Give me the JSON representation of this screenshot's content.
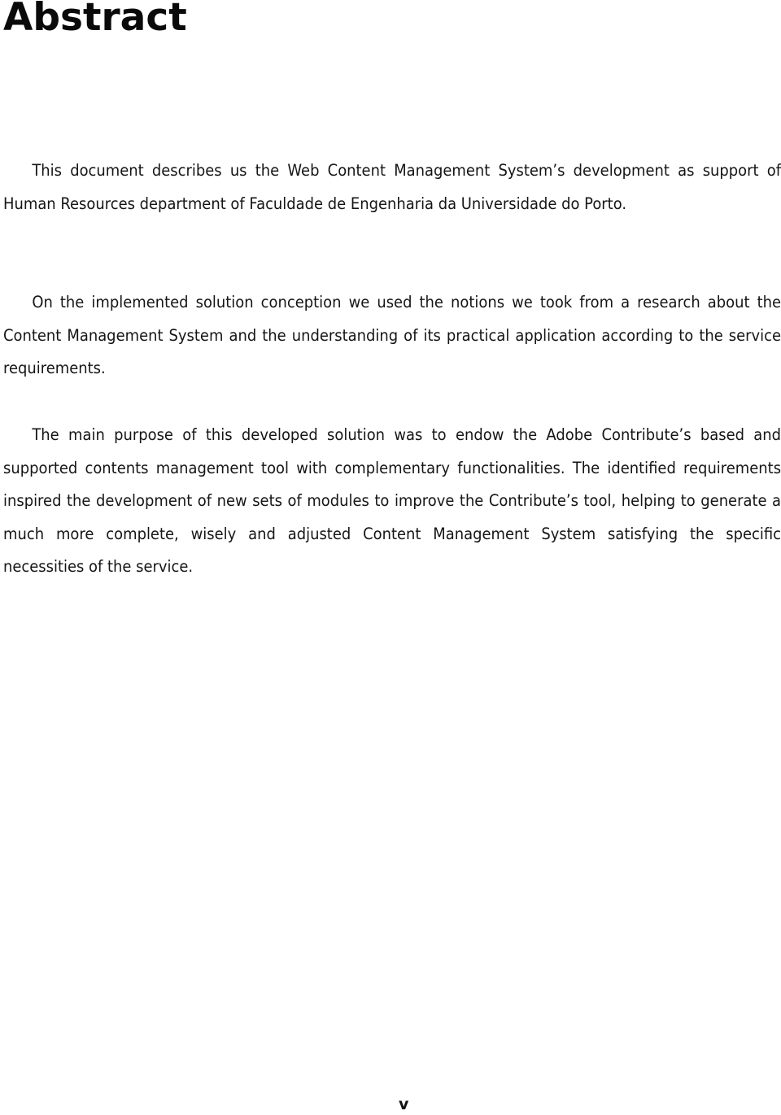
{
  "document": {
    "title": "Abstract",
    "paragraphs": [
      "This document describes us the Web Content Management System’s development as support of Human Resources department of Faculdade de Engenharia da Universidade do Porto.",
      "On the implemented solution conception we used the notions we took from a research about the Content Management System and the understanding of its practical application according to the service requirements.",
      "The main purpose of this developed solution was to endow the Adobe Contribute’s based and supported contents management tool with complementary functionalities. The identified requirements inspired the development of new sets of modules to improve the Contribute’s tool, helping to generate a much more complete, wisely and adjusted Content Management System satisfying the specific necessities of the service."
    ],
    "page_number": "v"
  }
}
